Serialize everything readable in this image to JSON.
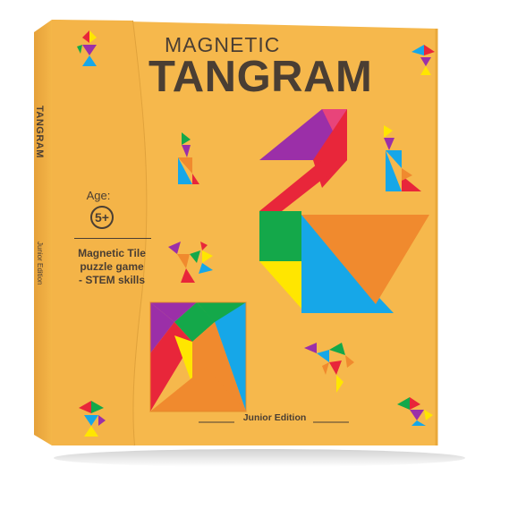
{
  "box": {
    "colors": {
      "cover": "#f6b84c",
      "cover_edge": "#e9a83a",
      "spine": "#eba840",
      "ink": "#4a3e33",
      "red": "#e8263a",
      "orange": "#f08a2e",
      "yellow": "#ffe600",
      "green": "#14a84a",
      "blue": "#16a7e8",
      "purple": "#9b2fa8",
      "pink": "#e8447a"
    },
    "cover": {
      "title_small": "MAGNETIC",
      "title_big": "TANGRAM",
      "edition": "Junior Edition"
    },
    "spine": {
      "title": "TANGRAM",
      "edition": "Junior Edition"
    },
    "side_panel": {
      "age_label": "Age:",
      "age_value": "5+",
      "description_lines": [
        "Magnetic Tile",
        "puzzle game",
        "- STEM skills"
      ]
    },
    "icons": [
      "tangram-swan-icon",
      "tangram-square-icon",
      "tangram-cat-icon",
      "tangram-rooster-icon",
      "tangram-runner-icon",
      "tangram-bird-icon",
      "tangram-dancer-icon"
    ]
  }
}
